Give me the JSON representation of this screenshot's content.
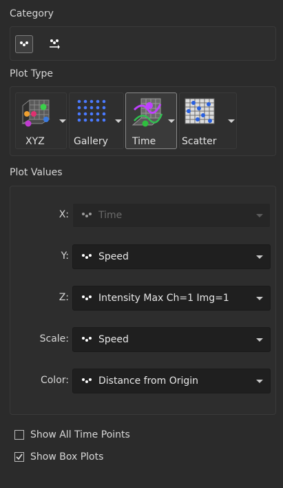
{
  "category": {
    "title": "Category",
    "buttons": [
      {
        "name": "spots-category-icon",
        "active": true
      },
      {
        "name": "tracks-category-icon",
        "active": false
      }
    ]
  },
  "plot_type": {
    "title": "Plot Type",
    "buttons": [
      {
        "label": "XYZ",
        "icon": "xyz-plot-icon",
        "active": false
      },
      {
        "label": "Gallery",
        "icon": "gallery-plot-icon",
        "active": false
      },
      {
        "label": "Time",
        "icon": "time-plot-icon",
        "active": true
      },
      {
        "label": "Scatter",
        "icon": "scatter-plot-icon",
        "active": false
      }
    ]
  },
  "plot_values": {
    "title": "Plot Values",
    "rows": [
      {
        "label": "X:",
        "value": "Time",
        "disabled": true
      },
      {
        "label": "Y:",
        "value": "Speed",
        "disabled": false
      },
      {
        "label": "Z:",
        "value": "Intensity Max Ch=1 Img=1",
        "disabled": false
      },
      {
        "label": "Scale:",
        "value": "Speed",
        "disabled": false
      },
      {
        "label": "Color:",
        "value": "Distance from Origin",
        "disabled": false
      }
    ]
  },
  "options": {
    "show_all_time_points": {
      "label": "Show All Time Points",
      "checked": false
    },
    "show_box_plots": {
      "label": "Show Box Plots",
      "checked": true
    }
  }
}
